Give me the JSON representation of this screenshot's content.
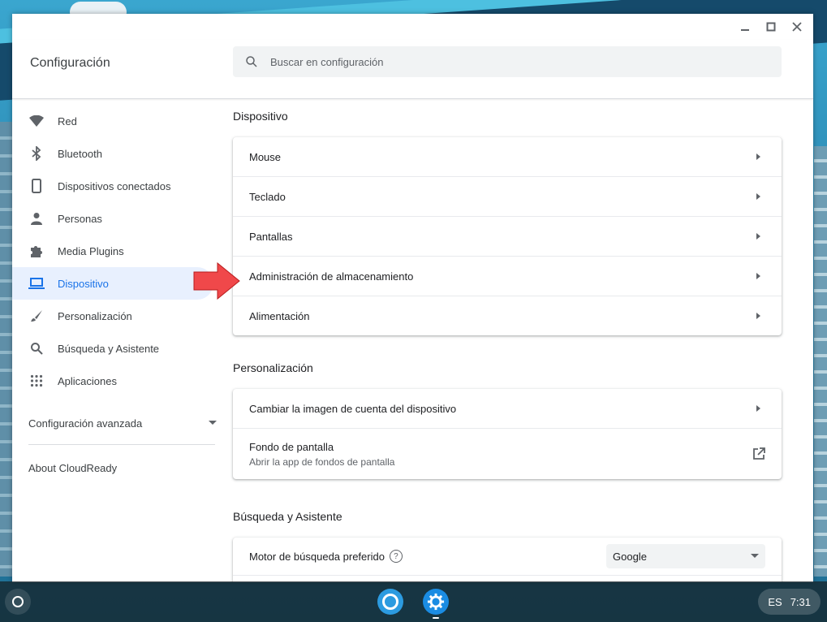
{
  "window": {
    "title": "Configuración"
  },
  "search": {
    "placeholder": "Buscar en configuración"
  },
  "sidebar": {
    "items": [
      {
        "label": "Red",
        "icon": "wifi-icon"
      },
      {
        "label": "Bluetooth",
        "icon": "bluetooth-icon"
      },
      {
        "label": "Dispositivos conectados",
        "icon": "phone-icon"
      },
      {
        "label": "Personas",
        "icon": "person-icon"
      },
      {
        "label": "Media Plugins",
        "icon": "puzzle-icon"
      },
      {
        "label": "Dispositivo",
        "icon": "laptop-icon",
        "active": true
      },
      {
        "label": "Personalización",
        "icon": "brush-icon"
      },
      {
        "label": "Búsqueda y Asistente",
        "icon": "search-icon"
      },
      {
        "label": "Aplicaciones",
        "icon": "apps-grid-icon"
      }
    ],
    "advanced": "Configuración avanzada",
    "about": "About CloudReady"
  },
  "main": {
    "sections": [
      {
        "title": "Dispositivo",
        "rows": [
          "Mouse",
          "Teclado",
          "Pantallas",
          "Administración de almacenamiento",
          "Alimentación"
        ]
      },
      {
        "title": "Personalización",
        "rows": [
          {
            "label": "Cambiar la imagen de cuenta del dispositivo"
          },
          {
            "label": "Fondo de pantalla",
            "sub": "Abrir la app de fondos de pantalla"
          }
        ]
      },
      {
        "title": "Búsqueda y Asistente",
        "rows": [
          {
            "label": "Motor de búsqueda preferido",
            "select_value": "Google"
          }
        ]
      }
    ]
  },
  "shelf": {
    "ime": "ES",
    "time": "7:31"
  },
  "colors": {
    "accent": "#1a73e8",
    "active_bg": "#e8f0fe",
    "annotation_arrow": "#f0484a"
  }
}
